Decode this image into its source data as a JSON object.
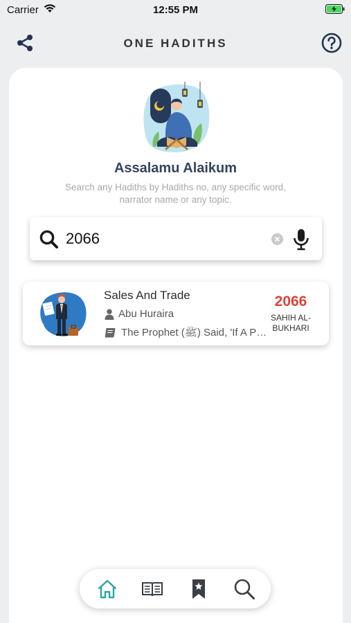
{
  "status_bar": {
    "carrier": "Carrier",
    "time": "12:55 PM"
  },
  "header": {
    "title": "ONE HADITHS",
    "share_icon": "share-icon",
    "help_icon": "help-circle-icon"
  },
  "welcome": {
    "greeting": "Assalamu Alaikum",
    "subtitle": "Search any Hadiths by Hadiths no, any specific word, narrator name or any topic."
  },
  "search": {
    "value": "2066",
    "placeholder": "Search",
    "clear_icon": "clear-icon",
    "mic_icon": "microphone-icon"
  },
  "results": [
    {
      "title": "Sales And Trade",
      "narrator": "Abu Huraira",
      "snippet": "The Prophet (ﷺ) Said, 'If A Person...",
      "number": "2066",
      "collection": "SAHIH AL-BUKHARI"
    }
  ],
  "bottom_nav": {
    "items": [
      "home-icon",
      "book-open-icon",
      "bookmark-icon",
      "search-icon"
    ],
    "active": "home-icon"
  },
  "colors": {
    "accent": "#2aa6a1",
    "number": "#d9453b",
    "greeting": "#33445e",
    "background": "#eceeef"
  }
}
